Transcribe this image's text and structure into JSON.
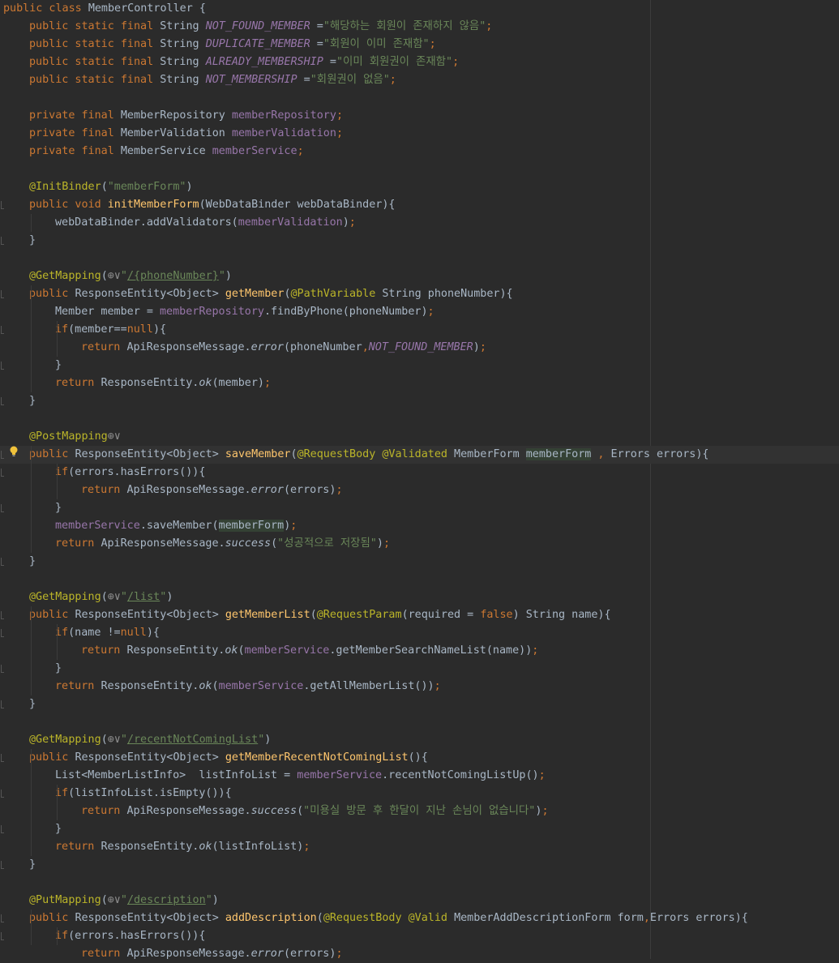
{
  "editor": {
    "language": "java",
    "class_name": "MemberController",
    "active_line_index": 25,
    "lines": [
      {
        "indent": 0,
        "fold": false,
        "tokens": [
          [
            "kw",
            "public class "
          ],
          [
            "",
            "MemberController {"
          ]
        ]
      },
      {
        "indent": 1,
        "fold": false,
        "tokens": [
          [
            "kw",
            "public static final "
          ],
          [
            "",
            "String "
          ],
          [
            "sf",
            "NOT_FOUND_MEMBER "
          ],
          [
            "",
            "="
          ],
          [
            "str",
            "\"해당하는 회원이 존재하지 않음\""
          ],
          [
            "kw",
            ";"
          ]
        ]
      },
      {
        "indent": 1,
        "fold": false,
        "tokens": [
          [
            "kw",
            "public static final "
          ],
          [
            "",
            "String "
          ],
          [
            "sf",
            "DUPLICATE_MEMBER "
          ],
          [
            "",
            "="
          ],
          [
            "str",
            "\"회원이 이미 존재함\""
          ],
          [
            "kw",
            ";"
          ]
        ]
      },
      {
        "indent": 1,
        "fold": false,
        "tokens": [
          [
            "kw",
            "public static final "
          ],
          [
            "",
            "String "
          ],
          [
            "sf",
            "ALREADY_MEMBERSHIP "
          ],
          [
            "",
            "="
          ],
          [
            "str",
            "\"이미 회원권이 존재함\""
          ],
          [
            "kw",
            ";"
          ]
        ]
      },
      {
        "indent": 1,
        "fold": false,
        "tokens": [
          [
            "kw",
            "public static final "
          ],
          [
            "",
            "String "
          ],
          [
            "sf",
            "NOT_MEMBERSHIP "
          ],
          [
            "",
            "="
          ],
          [
            "str",
            "\"회원권이 없음\""
          ],
          [
            "kw",
            ";"
          ]
        ]
      },
      {
        "indent": 0,
        "fold": false,
        "tokens": []
      },
      {
        "indent": 1,
        "fold": false,
        "tokens": [
          [
            "kw",
            "private final "
          ],
          [
            "",
            "MemberRepository "
          ],
          [
            "fld",
            "memberRepository"
          ],
          [
            "kw",
            ";"
          ]
        ]
      },
      {
        "indent": 1,
        "fold": false,
        "tokens": [
          [
            "kw",
            "private final "
          ],
          [
            "",
            "MemberValidation "
          ],
          [
            "fld",
            "memberValidation"
          ],
          [
            "kw",
            ";"
          ]
        ]
      },
      {
        "indent": 1,
        "fold": false,
        "tokens": [
          [
            "kw",
            "private final "
          ],
          [
            "",
            "MemberService "
          ],
          [
            "fld",
            "memberService"
          ],
          [
            "kw",
            ";"
          ]
        ]
      },
      {
        "indent": 0,
        "fold": false,
        "tokens": []
      },
      {
        "indent": 1,
        "fold": false,
        "tokens": [
          [
            "an",
            "@InitBinder"
          ],
          [
            "",
            "("
          ],
          [
            "str",
            "\"memberForm\""
          ],
          [
            "",
            ")"
          ]
        ]
      },
      {
        "indent": 1,
        "fold": true,
        "tokens": [
          [
            "kw",
            "public void "
          ],
          [
            "fn",
            "initMemberForm"
          ],
          [
            "",
            "(WebDataBinder webDataBinder){"
          ]
        ]
      },
      {
        "indent": 2,
        "fold": false,
        "tokens": [
          [
            "",
            "webDataBinder.addValidators("
          ],
          [
            "fld",
            "memberValidation"
          ],
          [
            "",
            ")"
          ],
          [
            "kw",
            ";"
          ]
        ]
      },
      {
        "indent": 1,
        "fold": true,
        "tokens": [
          [
            "",
            "}"
          ]
        ]
      },
      {
        "indent": 0,
        "fold": false,
        "tokens": []
      },
      {
        "indent": 1,
        "fold": false,
        "tokens": [
          [
            "an",
            "@GetMapping"
          ],
          [
            "",
            "("
          ],
          [
            "globe",
            "⊕∨"
          ],
          [
            "str",
            "\""
          ],
          [
            "url",
            "/{phoneNumber}"
          ],
          [
            "str",
            "\""
          ],
          [
            "",
            ")"
          ]
        ]
      },
      {
        "indent": 1,
        "fold": true,
        "tokens": [
          [
            "kw",
            "public "
          ],
          [
            "",
            "ResponseEntity<Object> "
          ],
          [
            "fn",
            "getMember"
          ],
          [
            "",
            "("
          ],
          [
            "an",
            "@PathVariable "
          ],
          [
            "",
            "String phoneNumber){"
          ]
        ]
      },
      {
        "indent": 2,
        "fold": false,
        "tokens": [
          [
            "",
            "Member member = "
          ],
          [
            "fld",
            "memberRepository"
          ],
          [
            "",
            ".findByPhone(phoneNumber)"
          ],
          [
            "kw",
            ";"
          ]
        ]
      },
      {
        "indent": 2,
        "fold": true,
        "tokens": [
          [
            "kw",
            "if"
          ],
          [
            "",
            "(member=="
          ],
          [
            "kw",
            "null"
          ],
          [
            "",
            "){"
          ]
        ]
      },
      {
        "indent": 3,
        "fold": false,
        "tokens": [
          [
            "kw",
            "return "
          ],
          [
            "",
            "ApiResponseMessage."
          ],
          [
            "it",
            "error"
          ],
          [
            "",
            "(phoneNumber"
          ],
          [
            "kw",
            ","
          ],
          [
            "sf",
            "NOT_FOUND_MEMBER"
          ],
          [
            "",
            ")"
          ],
          [
            "kw",
            ";"
          ]
        ]
      },
      {
        "indent": 2,
        "fold": true,
        "tokens": [
          [
            "",
            "}"
          ]
        ]
      },
      {
        "indent": 2,
        "fold": false,
        "tokens": [
          [
            "kw",
            "return "
          ],
          [
            "",
            "ResponseEntity."
          ],
          [
            "it",
            "ok"
          ],
          [
            "",
            "(member)"
          ],
          [
            "kw",
            ";"
          ]
        ]
      },
      {
        "indent": 1,
        "fold": true,
        "tokens": [
          [
            "",
            "}"
          ]
        ]
      },
      {
        "indent": 0,
        "fold": false,
        "tokens": []
      },
      {
        "indent": 1,
        "fold": false,
        "tokens": [
          [
            "an",
            "@PostMapping"
          ],
          [
            "globe",
            "⊕∨"
          ]
        ]
      },
      {
        "indent": 1,
        "fold": true,
        "tokens": [
          [
            "kw",
            "public "
          ],
          [
            "",
            "ResponseEntity<Object> "
          ],
          [
            "fn",
            "saveMember"
          ],
          [
            "",
            "("
          ],
          [
            "an",
            "@RequestBody @Validated "
          ],
          [
            "",
            "MemberForm "
          ],
          [
            "ref",
            "memberForm"
          ],
          [
            "",
            " "
          ],
          [
            "kw",
            ", "
          ],
          [
            "",
            "Errors errors){"
          ]
        ]
      },
      {
        "indent": 2,
        "fold": true,
        "tokens": [
          [
            "kw",
            "if"
          ],
          [
            "",
            "(errors.hasErrors()){"
          ]
        ]
      },
      {
        "indent": 3,
        "fold": false,
        "tokens": [
          [
            "kw",
            "return "
          ],
          [
            "",
            "ApiResponseMessage."
          ],
          [
            "it",
            "error"
          ],
          [
            "",
            "(errors)"
          ],
          [
            "kw",
            ";"
          ]
        ]
      },
      {
        "indent": 2,
        "fold": true,
        "tokens": [
          [
            "",
            "}"
          ]
        ]
      },
      {
        "indent": 2,
        "fold": false,
        "tokens": [
          [
            "fld",
            "memberService"
          ],
          [
            "",
            ".saveMember("
          ],
          [
            "ref",
            "memberForm"
          ],
          [
            "",
            ")"
          ],
          [
            "kw",
            ";"
          ]
        ]
      },
      {
        "indent": 2,
        "fold": false,
        "tokens": [
          [
            "kw",
            "return "
          ],
          [
            "",
            "ApiResponseMessage."
          ],
          [
            "it",
            "success"
          ],
          [
            "",
            "("
          ],
          [
            "str",
            "\"성공적으로 저장됨\""
          ],
          [
            "",
            ")"
          ],
          [
            "kw",
            ";"
          ]
        ]
      },
      {
        "indent": 1,
        "fold": true,
        "tokens": [
          [
            "",
            "}"
          ]
        ]
      },
      {
        "indent": 0,
        "fold": false,
        "tokens": []
      },
      {
        "indent": 1,
        "fold": false,
        "tokens": [
          [
            "an",
            "@GetMapping"
          ],
          [
            "",
            "("
          ],
          [
            "globe",
            "⊕∨"
          ],
          [
            "str",
            "\""
          ],
          [
            "url",
            "/list"
          ],
          [
            "str",
            "\""
          ],
          [
            "",
            ")"
          ]
        ]
      },
      {
        "indent": 1,
        "fold": true,
        "tokens": [
          [
            "kw",
            "public "
          ],
          [
            "",
            "ResponseEntity<Object> "
          ],
          [
            "fn",
            "getMemberList"
          ],
          [
            "",
            "("
          ],
          [
            "an",
            "@RequestParam"
          ],
          [
            "",
            "(required = "
          ],
          [
            "kw",
            "false"
          ],
          [
            "",
            ") String name){"
          ]
        ]
      },
      {
        "indent": 2,
        "fold": true,
        "tokens": [
          [
            "kw",
            "if"
          ],
          [
            "",
            "(name !="
          ],
          [
            "kw",
            "null"
          ],
          [
            "",
            "){"
          ]
        ]
      },
      {
        "indent": 3,
        "fold": false,
        "tokens": [
          [
            "kw",
            "return "
          ],
          [
            "",
            "ResponseEntity."
          ],
          [
            "it",
            "ok"
          ],
          [
            "",
            "("
          ],
          [
            "fld",
            "memberService"
          ],
          [
            "",
            ".getMemberSearchNameList(name))"
          ],
          [
            "kw",
            ";"
          ]
        ]
      },
      {
        "indent": 2,
        "fold": true,
        "tokens": [
          [
            "",
            "}"
          ]
        ]
      },
      {
        "indent": 2,
        "fold": false,
        "tokens": [
          [
            "kw",
            "return "
          ],
          [
            "",
            "ResponseEntity."
          ],
          [
            "it",
            "ok"
          ],
          [
            "",
            "("
          ],
          [
            "fld",
            "memberService"
          ],
          [
            "",
            ".getAllMemberList())"
          ],
          [
            "kw",
            ";"
          ]
        ]
      },
      {
        "indent": 1,
        "fold": true,
        "tokens": [
          [
            "",
            "}"
          ]
        ]
      },
      {
        "indent": 0,
        "fold": false,
        "tokens": []
      },
      {
        "indent": 1,
        "fold": false,
        "tokens": [
          [
            "an",
            "@GetMapping"
          ],
          [
            "",
            "("
          ],
          [
            "globe",
            "⊕∨"
          ],
          [
            "str",
            "\""
          ],
          [
            "url",
            "/recentNotComingList"
          ],
          [
            "str",
            "\""
          ],
          [
            "",
            ")"
          ]
        ]
      },
      {
        "indent": 1,
        "fold": true,
        "tokens": [
          [
            "kw",
            "public "
          ],
          [
            "",
            "ResponseEntity<Object> "
          ],
          [
            "fn",
            "getMemberRecentNotComingList"
          ],
          [
            "",
            "(){"
          ]
        ]
      },
      {
        "indent": 2,
        "fold": false,
        "tokens": [
          [
            "",
            "List<MemberListInfo>  listInfoList = "
          ],
          [
            "fld",
            "memberService"
          ],
          [
            "",
            ".recentNotComingListUp()"
          ],
          [
            "kw",
            ";"
          ]
        ]
      },
      {
        "indent": 2,
        "fold": true,
        "tokens": [
          [
            "kw",
            "if"
          ],
          [
            "",
            "(listInfoList.isEmpty()){"
          ]
        ]
      },
      {
        "indent": 3,
        "fold": false,
        "tokens": [
          [
            "kw",
            "return "
          ],
          [
            "",
            "ApiResponseMessage."
          ],
          [
            "it",
            "success"
          ],
          [
            "",
            "("
          ],
          [
            "str",
            "\"미용실 방문 후 한달이 지난 손님이 없습니다\""
          ],
          [
            "",
            ")"
          ],
          [
            "kw",
            ";"
          ]
        ]
      },
      {
        "indent": 2,
        "fold": true,
        "tokens": [
          [
            "",
            "}"
          ]
        ]
      },
      {
        "indent": 2,
        "fold": false,
        "tokens": [
          [
            "kw",
            "return "
          ],
          [
            "",
            "ResponseEntity."
          ],
          [
            "it",
            "ok"
          ],
          [
            "",
            "(listInfoList)"
          ],
          [
            "kw",
            ";"
          ]
        ]
      },
      {
        "indent": 1,
        "fold": true,
        "tokens": [
          [
            "",
            "}"
          ]
        ]
      },
      {
        "indent": 0,
        "fold": false,
        "tokens": []
      },
      {
        "indent": 1,
        "fold": false,
        "tokens": [
          [
            "an",
            "@PutMapping"
          ],
          [
            "",
            "("
          ],
          [
            "globe",
            "⊕∨"
          ],
          [
            "str",
            "\""
          ],
          [
            "url",
            "/description"
          ],
          [
            "str",
            "\""
          ],
          [
            "",
            ")"
          ]
        ]
      },
      {
        "indent": 1,
        "fold": true,
        "tokens": [
          [
            "kw",
            "public "
          ],
          [
            "",
            "ResponseEntity<Object> "
          ],
          [
            "fn",
            "addDescription"
          ],
          [
            "",
            "("
          ],
          [
            "an",
            "@RequestBody @Valid "
          ],
          [
            "",
            "MemberAddDescriptionForm form"
          ],
          [
            "kw",
            ","
          ],
          [
            "",
            "Errors errors){"
          ]
        ]
      },
      {
        "indent": 2,
        "fold": true,
        "tokens": [
          [
            "kw",
            "if"
          ],
          [
            "",
            "(errors.hasErrors()){"
          ]
        ]
      },
      {
        "indent": 3,
        "fold": false,
        "tokens": [
          [
            "kw",
            "return "
          ],
          [
            "",
            "ApiResponseMessage."
          ],
          [
            "it",
            "error"
          ],
          [
            "",
            "(errors)"
          ],
          [
            "kw",
            ";"
          ]
        ]
      }
    ]
  }
}
